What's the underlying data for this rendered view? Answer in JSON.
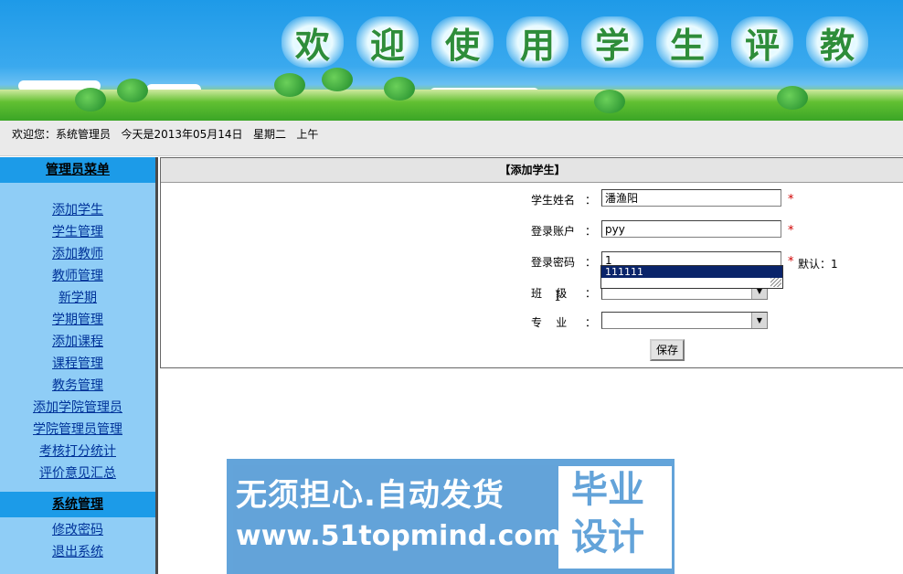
{
  "banner": {
    "title_chars": [
      "欢",
      "迎",
      "使",
      "用",
      "学",
      "生",
      "评",
      "教"
    ]
  },
  "welcome": {
    "text": "欢迎您：系统管理员   今天是2013年05月14日   星期二   上午"
  },
  "sidebar": {
    "admin_title": "管理员菜单",
    "admin_items": [
      "添加学生",
      "学生管理",
      "添加教师",
      "教师管理",
      "新学期",
      "学期管理",
      "添加课程",
      "课程管理",
      "教务管理",
      "添加学院管理员",
      "学院管理员管理",
      "考核打分统计",
      "评价意见汇总"
    ],
    "system_title": "系统管理",
    "system_items": [
      "修改密码",
      "退出系统"
    ]
  },
  "form": {
    "header": "【添加学生】",
    "name_label": "学生姓名",
    "name_value": "潘渔阳",
    "account_label": "登录账户",
    "account_value": "pyy",
    "password_label": "登录密码",
    "password_value": "1",
    "password_note": "默认：1",
    "autocomplete_option": "111111",
    "class_label": "班    级",
    "major_label": "专    业",
    "colon": "：",
    "required_mark": "*",
    "save_label": "保存"
  },
  "watermark": {
    "line1": "无须担心.自动发货",
    "line2": "www.51topmind.com",
    "badge_line1": "毕业",
    "badge_line2": "设计"
  }
}
